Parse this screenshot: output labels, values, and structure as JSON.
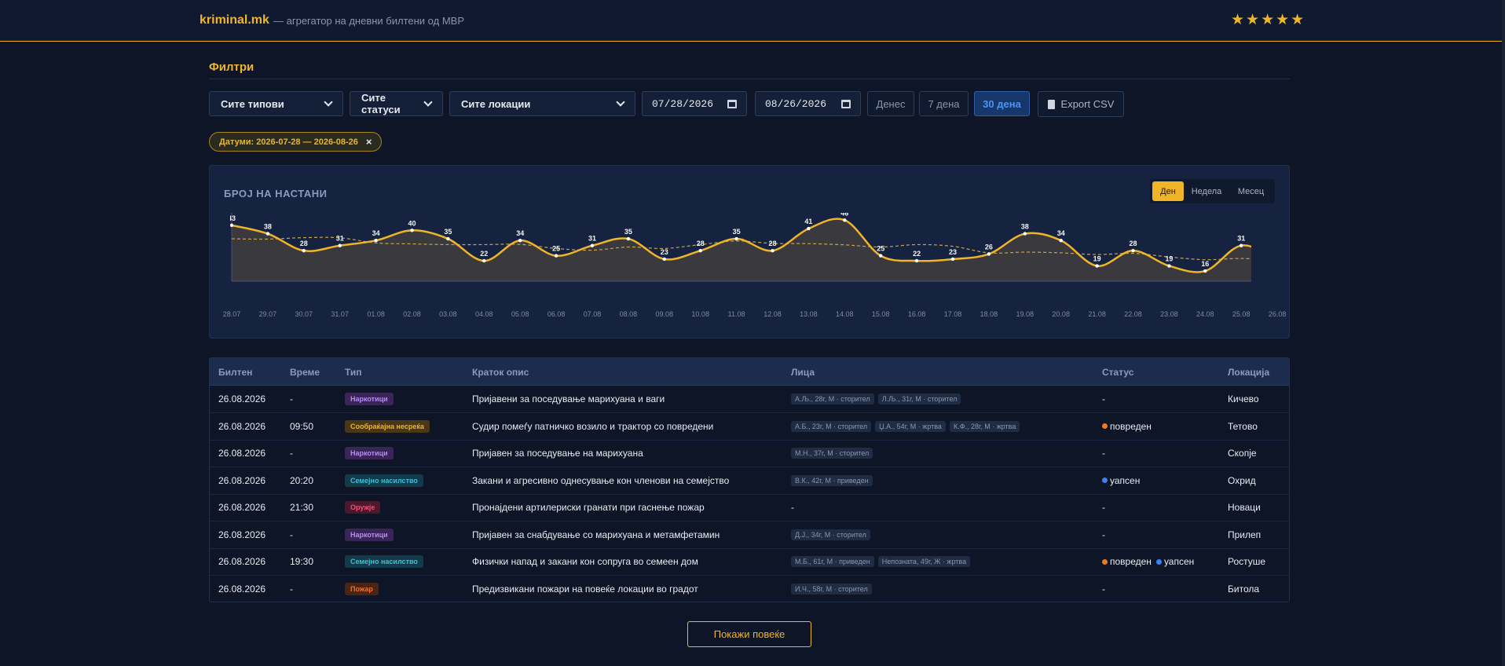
{
  "header": {
    "brand": "kriminal.mk",
    "tagline": "— агрегатор на дневни билтени од МВР",
    "stars": "★★★★★"
  },
  "filters": {
    "title": "Филтри",
    "type_select": "Сите типови",
    "status_select": "Сите статуси",
    "location_select": "Сите локации",
    "date_from": "07/28/2026",
    "date_to": "08/26/2026",
    "today": "Денес",
    "week": "7 дена",
    "month": "30 дена",
    "export": "Export CSV",
    "chip_label": "Датуми: 2026-07-28 — 2026-08-26",
    "chip_close": "×"
  },
  "chart": {
    "title": "БРОЈ НА НАСТАНИ",
    "toggle": [
      "Ден",
      "Недела",
      "Месец"
    ],
    "active_toggle": "Ден"
  },
  "chart_data": {
    "type": "area",
    "title": "БРОЈ НА НАСТАНИ",
    "categories": [
      "28.07",
      "29.07",
      "30.07",
      "31.07",
      "01.08",
      "02.08",
      "03.08",
      "04.08",
      "05.08",
      "06.08",
      "07.08",
      "08.08",
      "09.08",
      "10.08",
      "11.08",
      "12.08",
      "13.08",
      "14.08",
      "15.08",
      "16.08",
      "17.08",
      "18.08",
      "19.08",
      "20.08",
      "21.08",
      "22.08",
      "23.08",
      "24.08",
      "25.08",
      "26.08"
    ],
    "values": [
      43,
      38,
      28,
      31,
      34,
      40,
      35,
      22,
      34,
      25,
      31,
      35,
      23,
      28,
      35,
      28,
      41,
      46,
      25,
      22,
      23,
      26,
      38,
      34,
      19,
      28,
      19,
      16,
      31,
      23
    ],
    "trend_series": "dashed moving average",
    "ylim": [
      0,
      48
    ],
    "grid": false,
    "colors": {
      "line": "#f0b429",
      "fill": "#3a3a3e",
      "trend": "#c9a24a"
    }
  },
  "table": {
    "headers": [
      "Билтен",
      "Време",
      "Тип",
      "Краток опис",
      "Лица",
      "Статус",
      "Локација"
    ],
    "rows": [
      {
        "bulletin": "26.08.2026",
        "time": "-",
        "type": "Наркотици",
        "type_key": "drugs",
        "desc": "Пријавени за поседување марихуана и ваги",
        "persons": [
          "А.Љ., 28г, М · сторител",
          "Л.Љ., 31г, М · сторител"
        ],
        "status": [],
        "location": "Кичево"
      },
      {
        "bulletin": "26.08.2026",
        "time": "09:50",
        "type": "Сообраќајна несреќа",
        "type_key": "traffic",
        "desc": "Судир помеѓу патничко возило и трактор со повредени",
        "persons": [
          "А.Б., 23г, М · сторител",
          "Џ.А., 54г, М · жртва",
          "К.Ф., 28г, М · жртва"
        ],
        "status": [
          {
            "label": "повреден",
            "color": "#f07a1a"
          }
        ],
        "location": "Тетово"
      },
      {
        "bulletin": "26.08.2026",
        "time": "-",
        "type": "Наркотици",
        "type_key": "drugs",
        "desc": "Пријавен за поседување на марихуана",
        "persons": [
          "М.Н., 37г, М · сторител"
        ],
        "status": [],
        "location": "Скопје"
      },
      {
        "bulletin": "26.08.2026",
        "time": "20:20",
        "type": "Семејно насилство",
        "type_key": "family",
        "desc": "Закани и агресивно однесување кон членови на семејство",
        "persons": [
          "В.К., 42г, М · приведен"
        ],
        "status": [
          {
            "label": "уапсен",
            "color": "#3b82f6"
          }
        ],
        "location": "Охрид"
      },
      {
        "bulletin": "26.08.2026",
        "time": "21:30",
        "type": "Оружје",
        "type_key": "weapons",
        "desc": "Пронајдени артилериски гранати при гаснење пожар",
        "persons": [],
        "status": [],
        "location": "Новаци"
      },
      {
        "bulletin": "26.08.2026",
        "time": "-",
        "type": "Наркотици",
        "type_key": "drugs",
        "desc": "Пријавен за снабдување со марихуана и метамфетамин",
        "persons": [
          "Д.Ј., 34г, М · сторител"
        ],
        "status": [],
        "location": "Прилеп"
      },
      {
        "bulletin": "26.08.2026",
        "time": "19:30",
        "type": "Семејно насилство",
        "type_key": "family",
        "desc": "Физички напад и закани кон сопруга во семеен дом",
        "persons": [
          "М.Б., 61г, М · приведен",
          "Непозната, 49г, Ж · жртва"
        ],
        "status": [
          {
            "label": "повреден",
            "color": "#f07a1a"
          },
          {
            "label": "уапсен",
            "color": "#3b82f6"
          }
        ],
        "location": "Ростуше"
      },
      {
        "bulletin": "26.08.2026",
        "time": "-",
        "type": "Пожар",
        "type_key": "fire",
        "desc": "Предизвикани пожари на повеќе локации во градот",
        "persons": [
          "И.Ч., 58г, М · сторител"
        ],
        "status": [],
        "location": "Битола"
      }
    ],
    "empty_value": "-"
  },
  "type_colors": {
    "drugs": {
      "bg": "#3a2458",
      "fg": "#b58cf5"
    },
    "traffic": {
      "bg": "#4a3715",
      "fg": "#f0b429"
    },
    "family": {
      "bg": "#123a4a",
      "fg": "#3cc2d8"
    },
    "weapons": {
      "bg": "#4a1a2c",
      "fg": "#f0507a"
    },
    "fire": {
      "bg": "#4a2415",
      "fg": "#f0702a"
    }
  },
  "footer": {
    "more_button": "Покажи повеќе"
  }
}
